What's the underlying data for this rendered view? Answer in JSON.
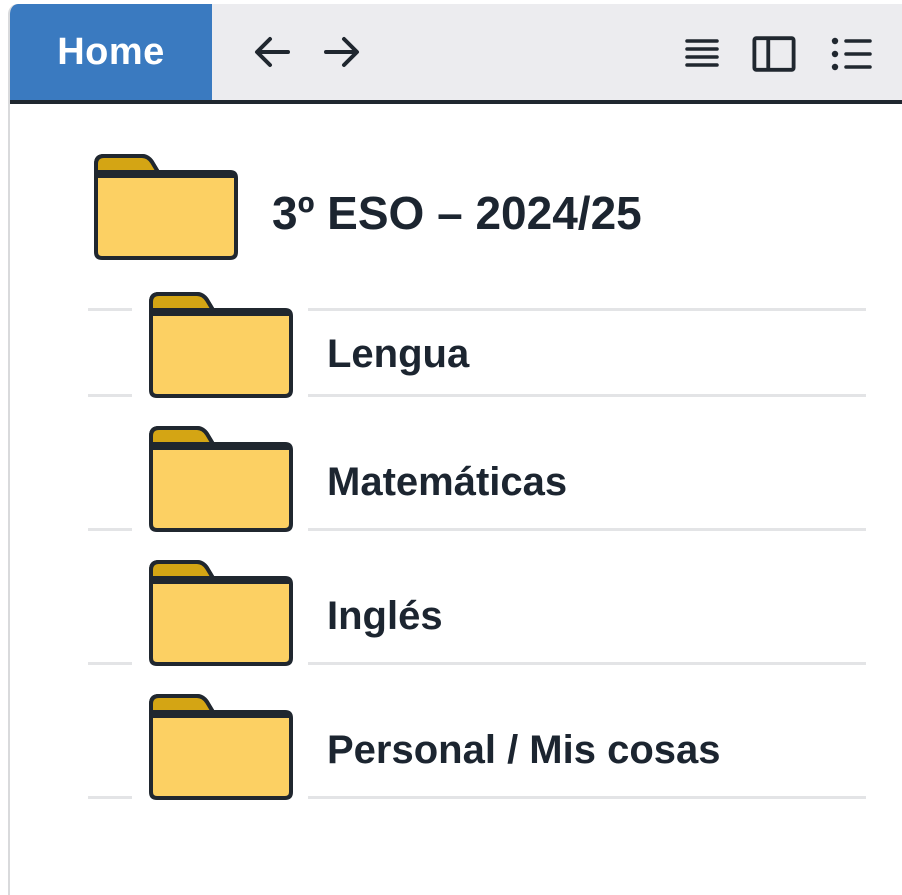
{
  "toolbar": {
    "home_label": "Home",
    "back_icon": "arrow-left-icon",
    "forward_icon": "arrow-right-icon",
    "view_icons": [
      "details-list-icon",
      "preview-pane-icon",
      "bulleted-list-icon"
    ]
  },
  "colors": {
    "accent": "#3a7ac0",
    "folder_fill": "#fcd063",
    "folder_tab": "#d4a514",
    "text": "#1c2530"
  },
  "root_folder": {
    "name": "3º ESO – 2024/25",
    "icon": "folder-icon"
  },
  "subfolders": [
    {
      "name": "Lengua",
      "icon": "folder-icon"
    },
    {
      "name": "Matemáticas",
      "icon": "folder-icon"
    },
    {
      "name": "Inglés",
      "icon": "folder-icon"
    },
    {
      "name": "Personal / Mis cosas",
      "icon": "folder-icon"
    }
  ]
}
